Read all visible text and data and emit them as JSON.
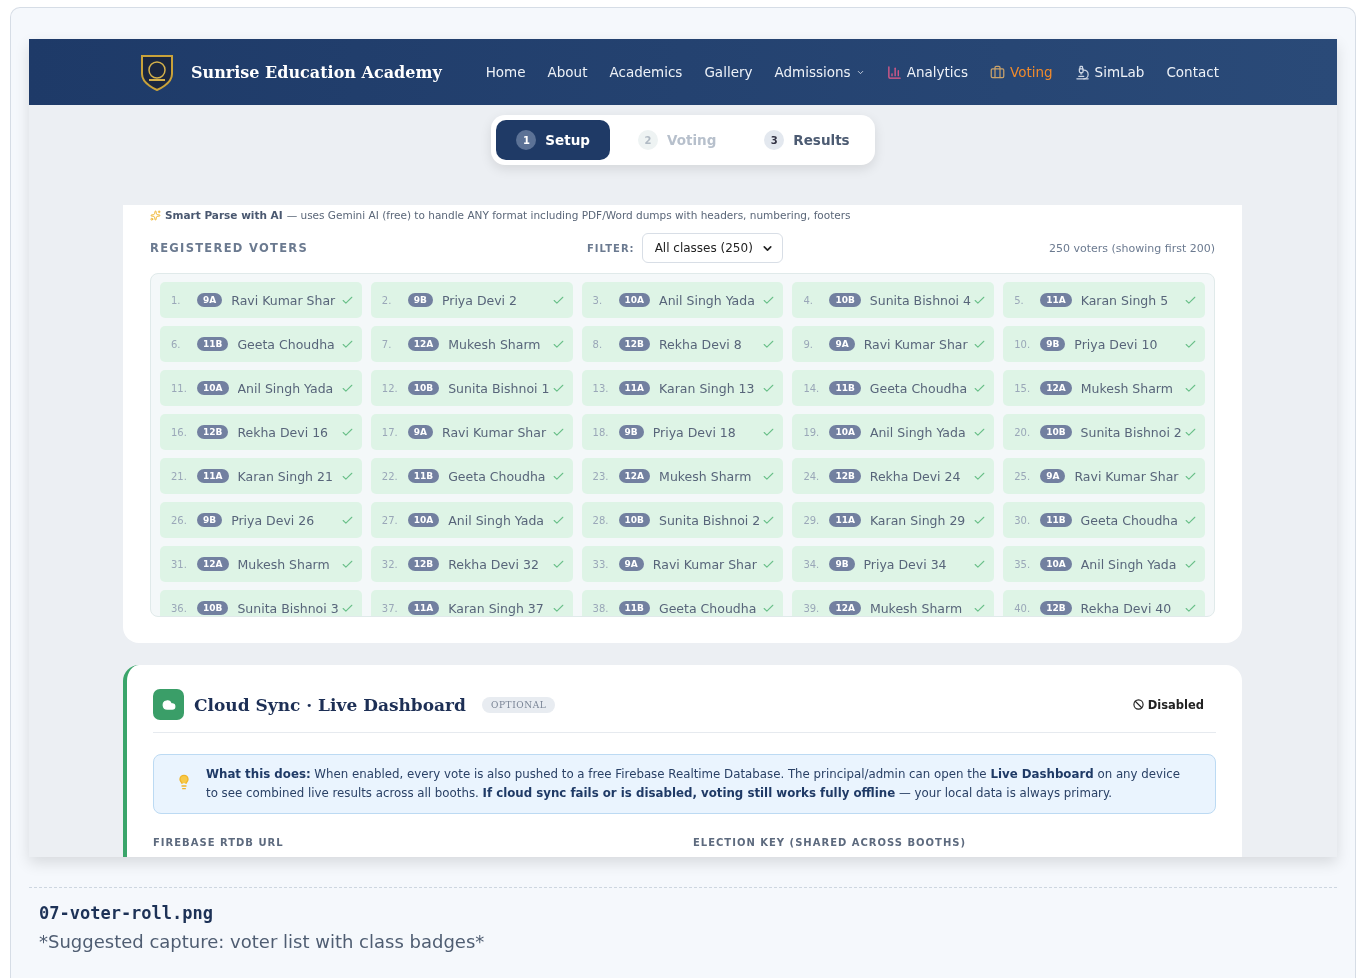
{
  "header": {
    "brand": "Sunrise Education Academy",
    "nav": [
      {
        "label": "Home",
        "kind": "plain",
        "selected": false,
        "dropdown": false
      },
      {
        "label": "About",
        "kind": "plain",
        "selected": false,
        "dropdown": false
      },
      {
        "label": "Academics",
        "kind": "plain",
        "selected": false,
        "dropdown": false
      },
      {
        "label": "Gallery",
        "kind": "plain",
        "selected": false,
        "dropdown": false
      },
      {
        "label": "Admissions",
        "kind": "plain",
        "selected": false,
        "dropdown": true
      },
      {
        "label": "Analytics",
        "kind": "chart",
        "selected": false,
        "dropdown": false
      },
      {
        "label": "Voting",
        "kind": "ballot",
        "selected": true,
        "dropdown": false
      },
      {
        "label": "SimLab",
        "kind": "microscope",
        "selected": false,
        "dropdown": false
      },
      {
        "label": "Contact",
        "kind": "plain",
        "selected": false,
        "dropdown": false
      }
    ]
  },
  "steps": [
    {
      "num": "1",
      "label": "Setup",
      "selected": true,
      "disabled": false
    },
    {
      "num": "2",
      "label": "Voting",
      "selected": false,
      "disabled": true
    },
    {
      "num": "3",
      "label": "Results",
      "selected": false,
      "disabled": false
    }
  ],
  "smart_parse": {
    "title": "Smart Parse with AI",
    "text": "— uses Gemini AI (free) to handle ANY format including PDF/Word dumps with headers, numbering, footers"
  },
  "voters_section": {
    "title": "REGISTERED VOTERS",
    "filter_label": "FILTER:",
    "filter_value": "All classes (250)",
    "count": "250 voters (showing first 200)"
  },
  "voters": [
    {
      "num": "1.",
      "cls": "9A",
      "name": "Ravi Kumar Shar",
      "verified": true
    },
    {
      "num": "2.",
      "cls": "9B",
      "name": "Priya Devi 2",
      "verified": true
    },
    {
      "num": "3.",
      "cls": "10A",
      "name": "Anil Singh Yada",
      "verified": true
    },
    {
      "num": "4.",
      "cls": "10B",
      "name": "Sunita Bishnoi 4",
      "verified": true
    },
    {
      "num": "5.",
      "cls": "11A",
      "name": "Karan Singh 5",
      "verified": true
    },
    {
      "num": "6.",
      "cls": "11B",
      "name": "Geeta Choudha",
      "verified": true
    },
    {
      "num": "7.",
      "cls": "12A",
      "name": "Mukesh Sharm",
      "verified": true
    },
    {
      "num": "8.",
      "cls": "12B",
      "name": "Rekha Devi 8",
      "verified": true
    },
    {
      "num": "9.",
      "cls": "9A",
      "name": "Ravi Kumar Shar",
      "verified": true
    },
    {
      "num": "10.",
      "cls": "9B",
      "name": "Priya Devi 10",
      "verified": true
    },
    {
      "num": "11.",
      "cls": "10A",
      "name": "Anil Singh Yada",
      "verified": true
    },
    {
      "num": "12.",
      "cls": "10B",
      "name": "Sunita Bishnoi 1",
      "verified": true
    },
    {
      "num": "13.",
      "cls": "11A",
      "name": "Karan Singh 13",
      "verified": true
    },
    {
      "num": "14.",
      "cls": "11B",
      "name": "Geeta Choudha",
      "verified": true
    },
    {
      "num": "15.",
      "cls": "12A",
      "name": "Mukesh Sharm",
      "verified": true
    },
    {
      "num": "16.",
      "cls": "12B",
      "name": "Rekha Devi 16",
      "verified": true
    },
    {
      "num": "17.",
      "cls": "9A",
      "name": "Ravi Kumar Shar",
      "verified": true
    },
    {
      "num": "18.",
      "cls": "9B",
      "name": "Priya Devi 18",
      "verified": true
    },
    {
      "num": "19.",
      "cls": "10A",
      "name": "Anil Singh Yada",
      "verified": true
    },
    {
      "num": "20.",
      "cls": "10B",
      "name": "Sunita Bishnoi 2",
      "verified": true
    },
    {
      "num": "21.",
      "cls": "11A",
      "name": "Karan Singh 21",
      "verified": true
    },
    {
      "num": "22.",
      "cls": "11B",
      "name": "Geeta Choudha",
      "verified": true
    },
    {
      "num": "23.",
      "cls": "12A",
      "name": "Mukesh Sharm",
      "verified": true
    },
    {
      "num": "24.",
      "cls": "12B",
      "name": "Rekha Devi 24",
      "verified": true
    },
    {
      "num": "25.",
      "cls": "9A",
      "name": "Ravi Kumar Shar",
      "verified": true
    },
    {
      "num": "26.",
      "cls": "9B",
      "name": "Priya Devi 26",
      "verified": true
    },
    {
      "num": "27.",
      "cls": "10A",
      "name": "Anil Singh Yada",
      "verified": true
    },
    {
      "num": "28.",
      "cls": "10B",
      "name": "Sunita Bishnoi 2",
      "verified": true
    },
    {
      "num": "29.",
      "cls": "11A",
      "name": "Karan Singh 29",
      "verified": true
    },
    {
      "num": "30.",
      "cls": "11B",
      "name": "Geeta Choudha",
      "verified": true
    },
    {
      "num": "31.",
      "cls": "12A",
      "name": "Mukesh Sharm",
      "verified": true
    },
    {
      "num": "32.",
      "cls": "12B",
      "name": "Rekha Devi 32",
      "verified": true
    },
    {
      "num": "33.",
      "cls": "9A",
      "name": "Ravi Kumar Shar",
      "verified": true
    },
    {
      "num": "34.",
      "cls": "9B",
      "name": "Priya Devi 34",
      "verified": true
    },
    {
      "num": "35.",
      "cls": "10A",
      "name": "Anil Singh Yada",
      "verified": true
    },
    {
      "num": "36.",
      "cls": "10B",
      "name": "Sunita Bishnoi 3",
      "verified": true
    },
    {
      "num": "37.",
      "cls": "11A",
      "name": "Karan Singh 37",
      "verified": true
    },
    {
      "num": "38.",
      "cls": "11B",
      "name": "Geeta Choudha",
      "verified": true
    },
    {
      "num": "39.",
      "cls": "12A",
      "name": "Mukesh Sharm",
      "verified": true
    },
    {
      "num": "40.",
      "cls": "12B",
      "name": "Rekha Devi 40",
      "verified": true
    }
  ],
  "cloud_sync": {
    "title": "Cloud Sync · Live Dashboard",
    "badge": "OPTIONAL",
    "status": "Disabled",
    "info": "**What this does:** When enabled, every vote is also pushed to a free Firebase Realtime Database. The principal/admin can open the **Live Dashboard** on any device to see combined live results across all booths. **If cloud sync fails or is disabled, voting still works fully offline** — your local data is always primary.",
    "fields": [
      "FIREBASE RTDB URL",
      "ELECTION KEY (SHARED ACROSS BOOTHS)"
    ]
  },
  "caption": {
    "filename": "07-voter-roll.png",
    "text": "*Suggested capture: voter list with class badges*"
  }
}
